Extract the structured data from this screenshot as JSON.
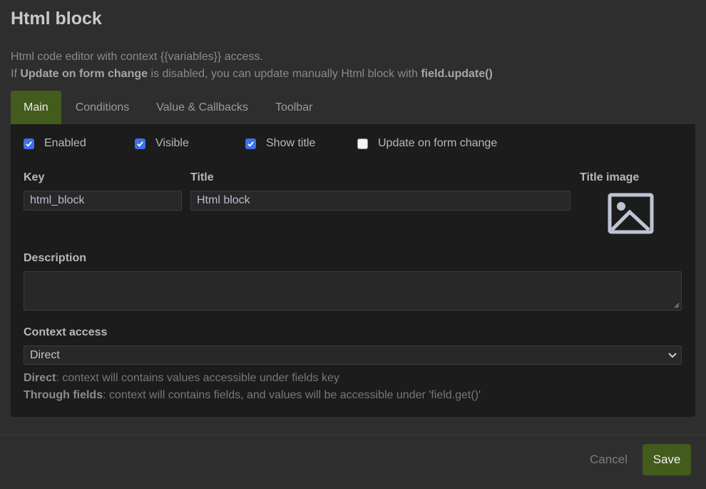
{
  "header": {
    "title": "Html block",
    "description_line1": "Html code editor with context {{variables}} access.",
    "description_line2_prefix": "If ",
    "description_line2_bold1": "Update on form change",
    "description_line2_middle": " is disabled, you can update manually Html block with ",
    "description_line2_bold2": "field.update()"
  },
  "tabs": [
    {
      "label": "Main",
      "active": true
    },
    {
      "label": "Conditions",
      "active": false
    },
    {
      "label": "Value & Callbacks",
      "active": false
    },
    {
      "label": "Toolbar",
      "active": false
    }
  ],
  "checkboxes": [
    {
      "label": "Enabled",
      "checked": true
    },
    {
      "label": "Visible",
      "checked": true
    },
    {
      "label": "Show title",
      "checked": true
    },
    {
      "label": "Update on form change",
      "checked": false
    }
  ],
  "fields": {
    "key_label": "Key",
    "key_value": "html_block",
    "title_label": "Title",
    "title_value": "Html block",
    "title_image_label": "Title image",
    "title_image_icon": "image-placeholder-icon",
    "description_label": "Description",
    "description_value": "",
    "context_access_label": "Context access",
    "context_access_value": "Direct"
  },
  "help": {
    "direct_bold": "Direct",
    "direct_text": ": context will contains values accessible under fields key",
    "through_bold": "Through fields",
    "through_text": ": context will contains fields, and values will be accessible under 'field.get()'"
  },
  "footer": {
    "cancel_label": "Cancel",
    "save_label": "Save"
  },
  "colors": {
    "accent": "#435b1d",
    "checkbox": "#3b72e8",
    "background": "#2e2e2e",
    "panel": "#1c1c1c"
  }
}
